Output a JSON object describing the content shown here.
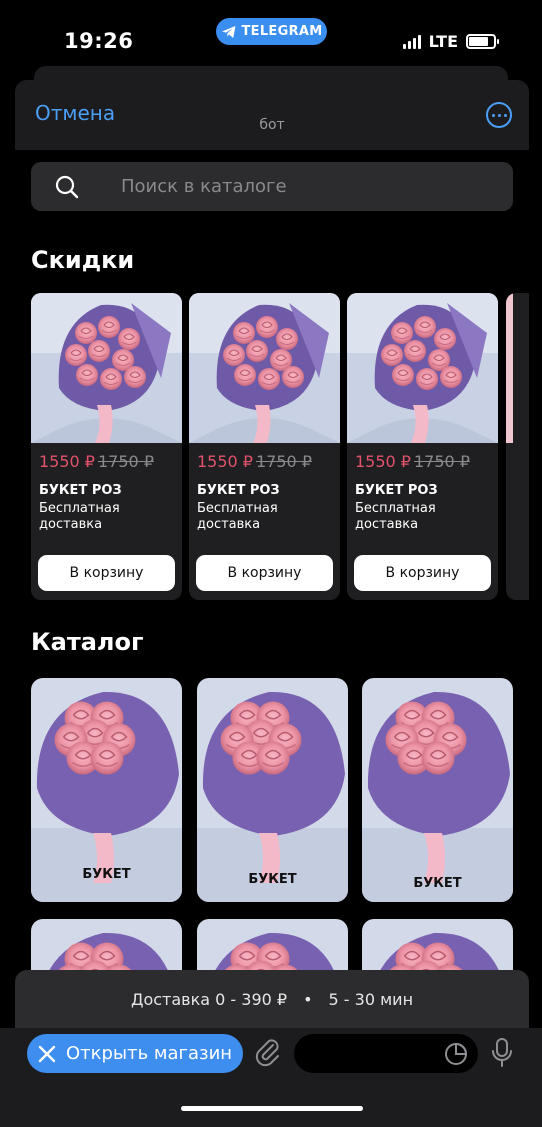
{
  "status_bar": {
    "time": "19:26",
    "app_pill": "TELEGRAM",
    "network": "LTE",
    "battery_level": 0.8,
    "signal_bars": 4
  },
  "header": {
    "cancel_label": "Отмена",
    "bot_name": "бот",
    "more_icon": "ellipsis-circle-icon"
  },
  "search": {
    "placeholder": "Поиск в каталоге",
    "icon": "search-icon"
  },
  "sales": {
    "title": "Скидки",
    "items": [
      {
        "price": "1550 ₽",
        "old_price": "1750 ₽",
        "name": "БУКЕТ РОЗ",
        "subtitle": "Бесплатная доставка",
        "button": "В корзину"
      },
      {
        "price": "1550 ₽",
        "old_price": "1750 ₽",
        "name": "БУКЕТ РОЗ",
        "subtitle": "Бесплатная доставка",
        "button": "В корзину"
      },
      {
        "price": "1550 ₽",
        "old_price": "1750 ₽",
        "name": "БУКЕТ РОЗ",
        "subtitle": "Бесплатная доставка",
        "button": "В корзину"
      }
    ]
  },
  "catalog": {
    "title": "Каталог",
    "items": [
      {
        "label": "БУКЕТ"
      },
      {
        "label": "БУКЕТ"
      },
      {
        "label": "БУКЕТ"
      }
    ]
  },
  "delivery_bar": {
    "cost": "Доставка 0 - 390 ₽",
    "separator": "•",
    "time": "5 - 30 мин"
  },
  "bottom_bar": {
    "open_shop_label": "Открыть магазин",
    "icons": [
      "close-icon",
      "paperclip-icon",
      "sticker-icon",
      "microphone-icon"
    ]
  },
  "colors": {
    "accent": "#4a9ff5",
    "button_blue": "#3d8eef",
    "sale_price": "#e2526a",
    "card_bg": "#1f1f21"
  }
}
